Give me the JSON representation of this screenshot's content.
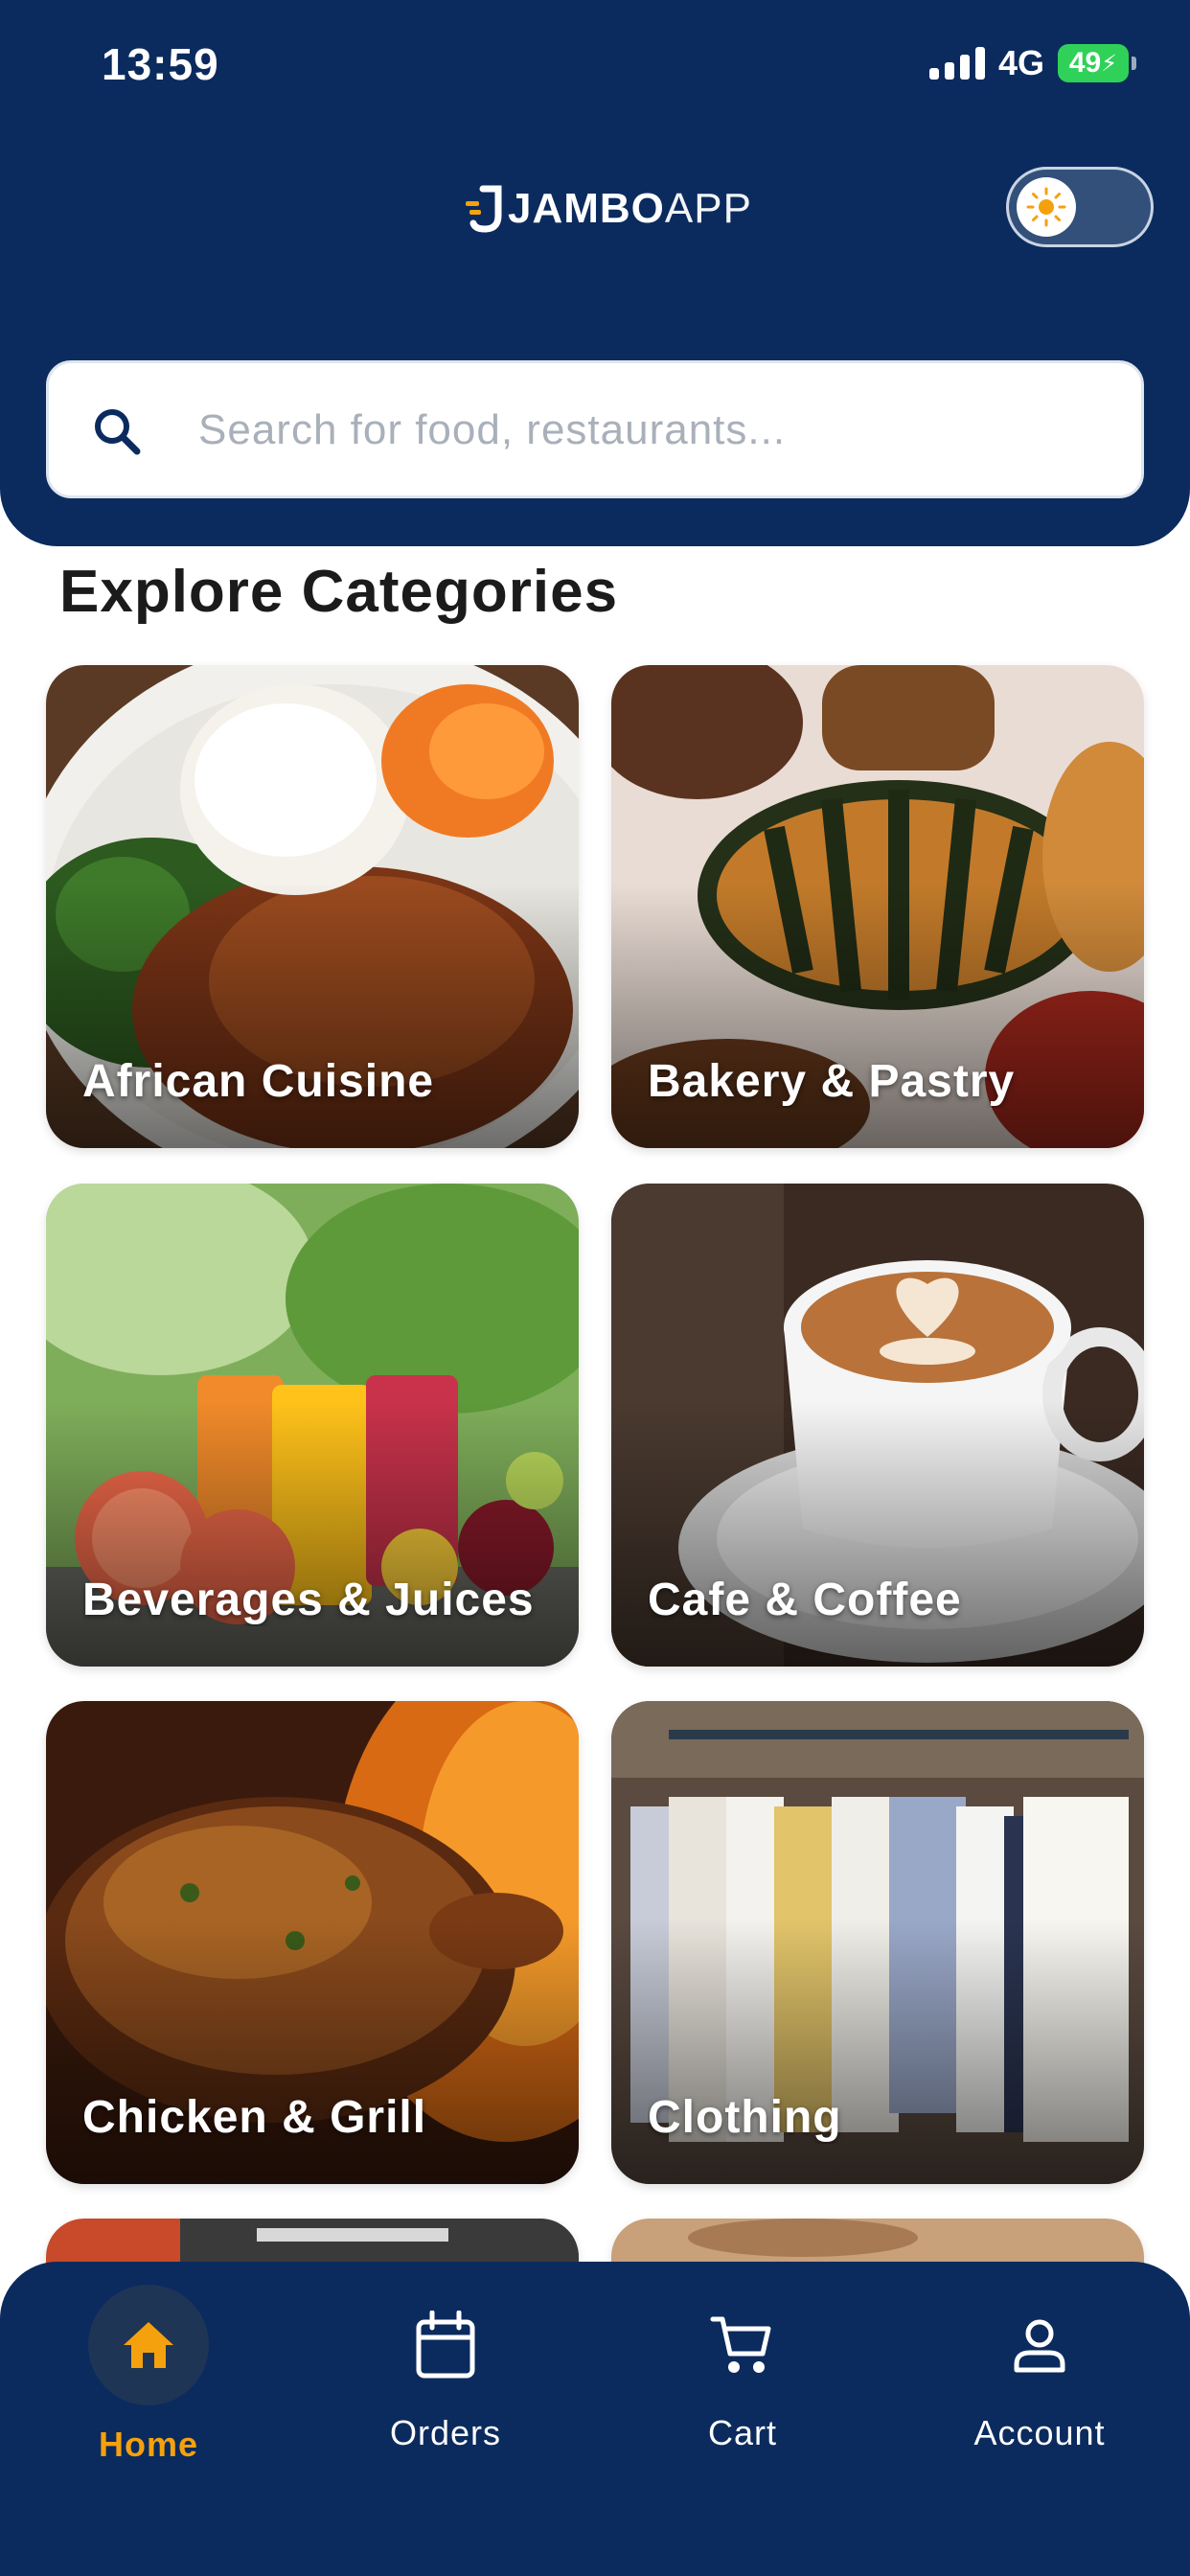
{
  "status_bar": {
    "time": "13:59",
    "network": "4G",
    "battery": "49"
  },
  "header": {
    "logo_bold": "JAMBO",
    "logo_light": "APP",
    "theme_toggle_icon": "sun-icon"
  },
  "search": {
    "placeholder": "Search for food, restaurants..."
  },
  "section": {
    "title": "Explore Categories"
  },
  "categories": [
    {
      "label": "African Cuisine"
    },
    {
      "label": "Bakery & Pastry"
    },
    {
      "label": "Beverages & Juices"
    },
    {
      "label": "Cafe & Coffee"
    },
    {
      "label": "Chicken & Grill"
    },
    {
      "label": "Clothing"
    }
  ],
  "bottom_nav": {
    "items": [
      {
        "label": "Home",
        "icon": "home-icon",
        "active": true
      },
      {
        "label": "Orders",
        "icon": "calendar-icon",
        "active": false
      },
      {
        "label": "Cart",
        "icon": "cart-icon",
        "active": false
      },
      {
        "label": "Account",
        "icon": "user-icon",
        "active": false
      }
    ]
  },
  "colors": {
    "primary": "#0b2b5e",
    "accent": "#f5a10d",
    "battery": "#30d158"
  }
}
